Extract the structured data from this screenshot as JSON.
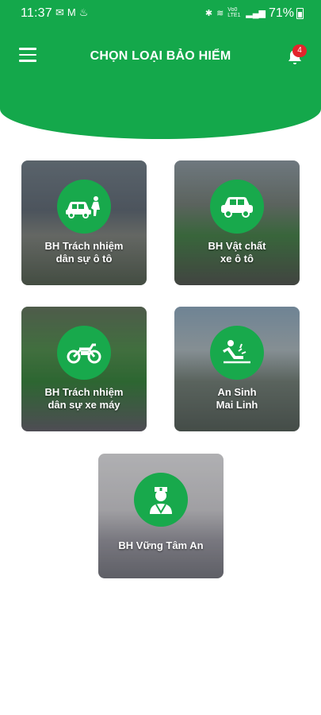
{
  "status_bar": {
    "time": "11:37",
    "battery": "71%",
    "network": "Vo0 LTE1"
  },
  "header": {
    "title": "CHỌN LOẠI BẢO HIỂM",
    "notification_count": "4"
  },
  "colors": {
    "brand_green": "#14a84b",
    "badge_red": "#e3242b"
  },
  "cards": [
    {
      "icon": "car-crash-icon",
      "line1": "BH Trách nhiệm",
      "line2": "dân sự ô tô"
    },
    {
      "icon": "car-icon",
      "line1": "BH Vật chất",
      "line2": "xe ô tô"
    },
    {
      "icon": "motorbike-icon",
      "line1": "BH Trách nhiệm",
      "line2": "dân sự xe máy"
    },
    {
      "icon": "person-falling-icon",
      "line1": "An Sinh",
      "line2": "Mai Linh"
    },
    {
      "icon": "nurse-icon",
      "line1": "BH Vững Tâm An",
      "line2": ""
    }
  ]
}
